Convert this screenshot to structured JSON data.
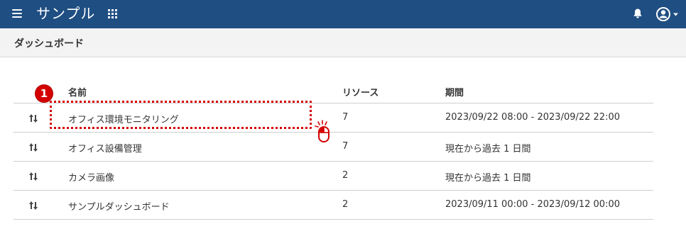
{
  "header": {
    "app_title": "サンプル",
    "menu_icon": "hamburger-menu-icon",
    "apps_icon": "grid-apps-icon",
    "notifications_icon": "bell-icon",
    "user_icon": "account-circle-icon"
  },
  "page": {
    "title": "ダッシュボード"
  },
  "table": {
    "columns": {
      "sort": "",
      "name": "名前",
      "resources": "リソース",
      "period": "期間"
    },
    "rows": [
      {
        "name": "オフィス環境モニタリング",
        "resources": "7",
        "period": "2023/09/22 08:00 - 2023/09/22 22:00"
      },
      {
        "name": "オフィス設備管理",
        "resources": "7",
        "period": "現在から過去 1 日間"
      },
      {
        "name": "カメラ画像",
        "resources": "2",
        "period": "現在から過去 1 日間"
      },
      {
        "name": "サンプルダッシュボード",
        "resources": "2",
        "period": "2023/09/11 00:00 - 2023/09/12 00:00"
      }
    ]
  },
  "annotation": {
    "step_number": "1",
    "highlight_color": "#d40000",
    "cursor_icon": "mouse-click-icon"
  },
  "colors": {
    "header_bg": "#1f4e82",
    "subheader_bg": "#f3f3f3"
  }
}
